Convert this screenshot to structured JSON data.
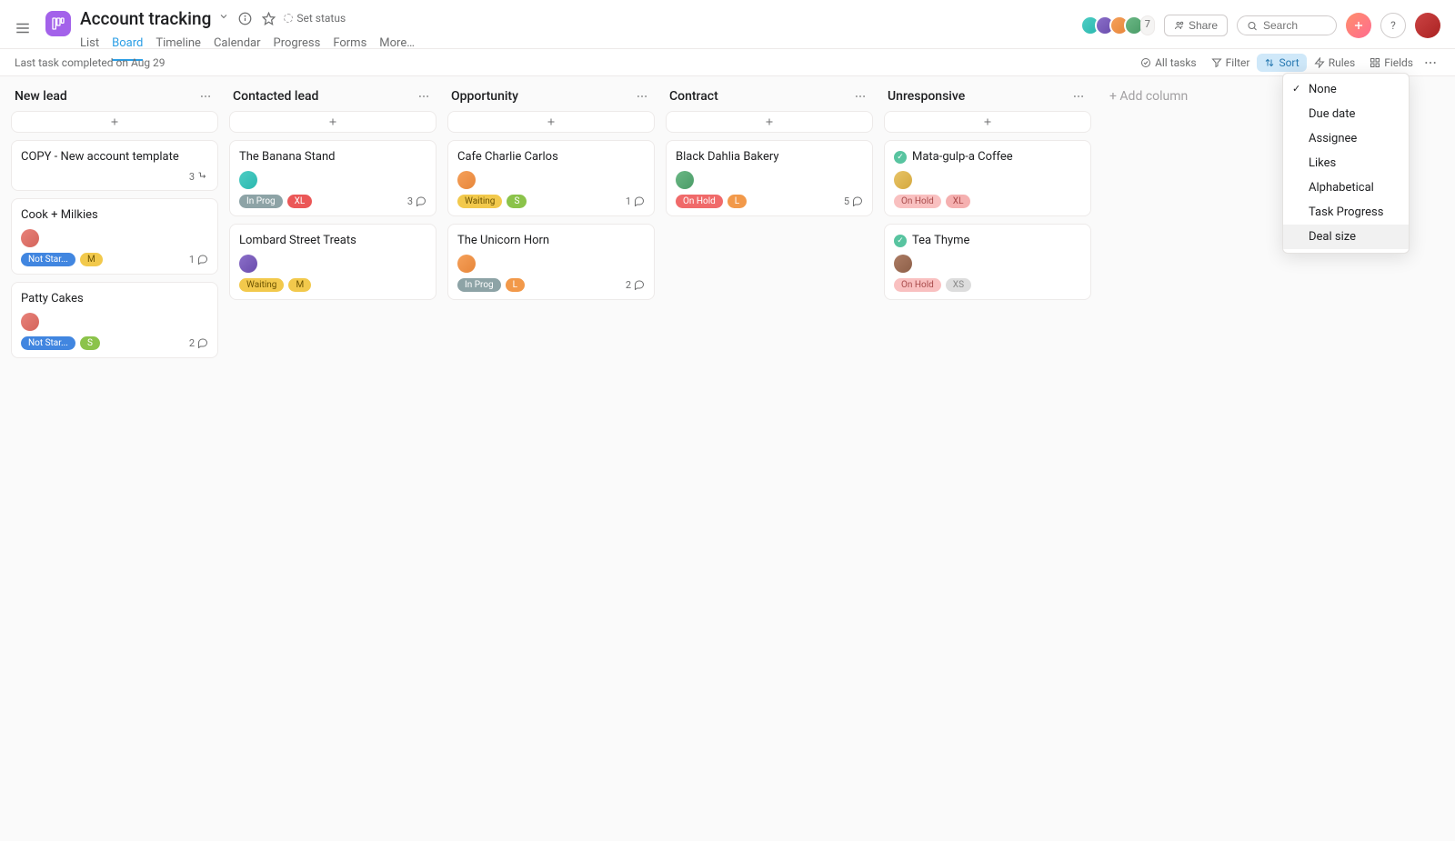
{
  "header": {
    "title": "Account tracking",
    "set_status": "Set status",
    "tabs": [
      "List",
      "Board",
      "Timeline",
      "Calendar",
      "Progress",
      "Forms",
      "More…"
    ],
    "active_tab": 1,
    "member_extra": "7",
    "share": "Share",
    "search_placeholder": "Search"
  },
  "toolbar": {
    "status": "Last task completed on Aug 29",
    "all_tasks": "All tasks",
    "filter": "Filter",
    "sort": "Sort",
    "rules": "Rules",
    "fields": "Fields"
  },
  "sort_dropdown": {
    "items": [
      "None",
      "Due date",
      "Assignee",
      "Likes",
      "Alphabetical",
      "Task Progress",
      "Deal size"
    ],
    "checked": 0,
    "hover": 6
  },
  "add_column": "+ Add column",
  "columns": [
    {
      "title": "New lead",
      "cards": [
        {
          "title": "COPY - New account template",
          "subtasks": 3
        },
        {
          "title": "Cook + Milkies",
          "avatar": "av-pink",
          "status": "Not Star...",
          "status_class": "status-notstarted",
          "size": "M",
          "size_class": "size-m",
          "comments": 1
        },
        {
          "title": "Patty Cakes",
          "avatar": "av-pink",
          "status": "Not Star...",
          "status_class": "status-notstarted",
          "size": "S",
          "size_class": "size-s",
          "comments": 2
        }
      ]
    },
    {
      "title": "Contacted lead",
      "cards": [
        {
          "title": "The Banana Stand",
          "avatar": "av-teal",
          "status": "In Prog",
          "status_class": "status-inprog",
          "size": "XL",
          "size_class": "size-xl",
          "comments": 3
        },
        {
          "title": "Lombard Street Treats",
          "avatar": "av-purple",
          "status": "Waiting",
          "status_class": "status-waiting",
          "size": "M",
          "size_class": "size-m"
        }
      ]
    },
    {
      "title": "Opportunity",
      "cards": [
        {
          "title": "Cafe Charlie Carlos",
          "avatar": "av-orange",
          "status": "Waiting",
          "status_class": "status-waiting",
          "size": "S",
          "size_class": "size-s",
          "comments": 1
        },
        {
          "title": "The Unicorn Horn",
          "avatar": "av-orange",
          "status": "In Prog",
          "status_class": "status-inprog",
          "size": "L",
          "size_class": "size-l",
          "comments": 2
        }
      ]
    },
    {
      "title": "Contract",
      "cards": [
        {
          "title": "Black Dahlia Bakery",
          "avatar": "av-green",
          "status": "On Hold",
          "status_class": "status-onhold",
          "size": "L",
          "size_class": "size-l",
          "comments": 5
        }
      ]
    },
    {
      "title": "Unresponsive",
      "cards": [
        {
          "title": "Mata-gulp-a Coffee",
          "done": true,
          "avatar": "av-yellow",
          "status": "On Hold",
          "status_class": "status-onhold-faded",
          "size": "XL",
          "size_class": "size-xl-faded"
        },
        {
          "title": "Tea Thyme",
          "done": true,
          "avatar": "av-brown",
          "status": "On Hold",
          "status_class": "status-onhold-faded",
          "size": "XS",
          "size_class": "size-xs-faded"
        }
      ]
    }
  ]
}
